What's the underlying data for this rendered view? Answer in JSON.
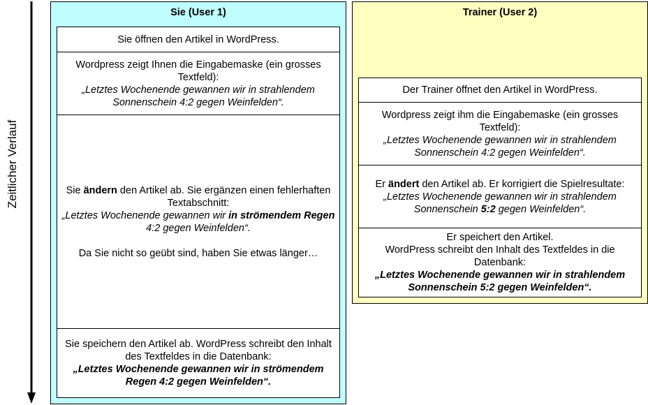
{
  "timeline_label": "Zeitlicher Verlauf",
  "user1": {
    "title": "Sie (User 1)",
    "step1": "Sie öffnen den Artikel in WordPress.",
    "step2": {
      "text": "Wordpress zeigt Ihnen die Eingabemaske (ein grosses Textfeld):",
      "quote": "„Letztes Wochenende gewannen wir in strahlendem Sonnenschein 4:2 gegen Weinfelden“."
    },
    "step3": {
      "pre": "Sie ",
      "bold": "ändern",
      "post": " den Artikel ab. Sie ergänzen einen fehlerhaften Textabschnitt:",
      "quote_pre": "„Letztes Wochenende gewannen wir ",
      "quote_bold": "in strömendem Regen",
      "quote_post": " 4:2 gegen Weinfelden“.",
      "note": "Da Sie nicht so geübt sind, haben Sie etwas länger…"
    },
    "step4": {
      "text": "Sie speichern den Artikel ab. WordPress schreibt den Inhalt des Textfeldes in die Datenbank:",
      "quote": "„Letztes Wochenende gewannen wir in strömendem Regen 4:2 gegen Weinfelden“."
    }
  },
  "user2": {
    "title": "Trainer (User 2)",
    "step1": "Der Trainer öffnet den Artikel in WordPress.",
    "step2": {
      "text": "Wordpress zeigt ihm die Eingabemaske (ein grosses Textfeld):",
      "quote": "„Letztes Wochenende gewannen wir in strahlendem Sonnenschein 4:2 gegen Weinfelden“."
    },
    "step3": {
      "pre": "Er ",
      "bold": "ändert",
      "post": " den Artikel ab. Er korrigiert die Spielresultate:",
      "quote_pre": "„Letztes Wochenende gewannen wir in strahlendem Sonnenschein ",
      "quote_bold": "5:2",
      "quote_post": " gegen Weinfelden“."
    },
    "step4": {
      "text1": "Er speichert den Artikel.",
      "text2": "WordPress schreibt den Inhalt des Textfeldes in die Datenbank:",
      "quote": "„Letztes Wochenende gewannen wir in strahlendem Sonnenschein 5:2 gegen Weinfelden“."
    }
  },
  "colors": {
    "user1_bg": "#c0ffff",
    "user2_bg": "#ffffc0"
  }
}
